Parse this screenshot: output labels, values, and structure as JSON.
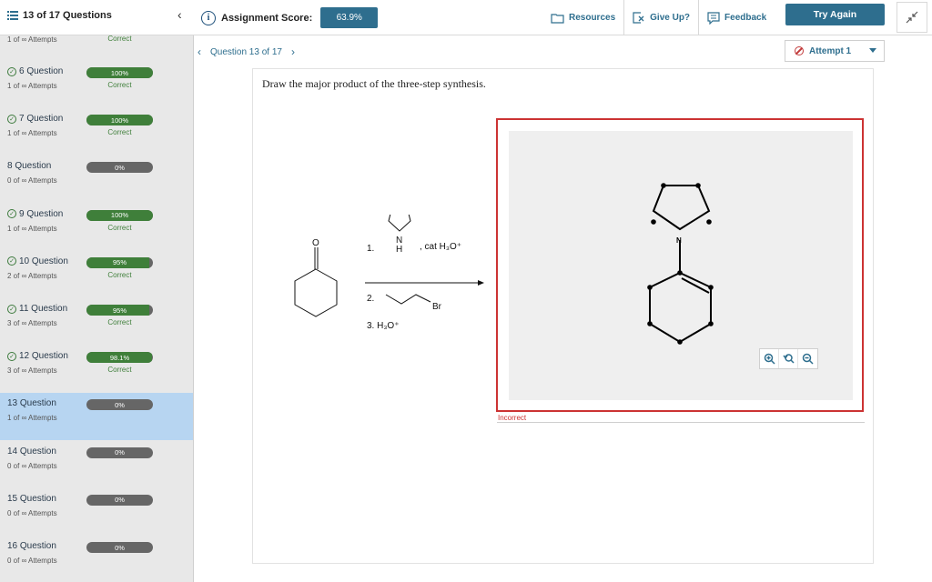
{
  "header": {
    "question_count": "13 of 17 Questions",
    "score_label": "Assignment Score:",
    "score_value": "63.9%",
    "resources_label": "Resources",
    "give_up_label": "Give Up?",
    "feedback_label": "Feedback",
    "try_again_label": "Try Again"
  },
  "sidebar": {
    "partial_top": {
      "attempts": "1 of ∞ Attempts",
      "status": "Correct"
    },
    "items": [
      {
        "title": "6 Question",
        "attempts": "1 of ∞ Attempts",
        "percent": "100%",
        "fill": 1.0,
        "status": "Correct",
        "checked": true
      },
      {
        "title": "7 Question",
        "attempts": "1 of ∞ Attempts",
        "percent": "100%",
        "fill": 1.0,
        "status": "Correct",
        "checked": true
      },
      {
        "title": "8 Question",
        "attempts": "0 of ∞ Attempts",
        "percent": "0%",
        "fill": 0,
        "status": "",
        "checked": false
      },
      {
        "title": "9 Question",
        "attempts": "1 of ∞ Attempts",
        "percent": "100%",
        "fill": 1.0,
        "status": "Correct",
        "checked": true
      },
      {
        "title": "10 Question",
        "attempts": "2 of ∞ Attempts",
        "percent": "95%",
        "fill": 0.95,
        "status": "Correct",
        "checked": true
      },
      {
        "title": "11 Question",
        "attempts": "3 of ∞ Attempts",
        "percent": "95%",
        "fill": 0.95,
        "status": "Correct",
        "checked": true
      },
      {
        "title": "12 Question",
        "attempts": "3 of ∞ Attempts",
        "percent": "98.1%",
        "fill": 0.981,
        "status": "Correct",
        "checked": true
      },
      {
        "title": "13 Question",
        "attempts": "1 of ∞ Attempts",
        "percent": "0%",
        "fill": 0,
        "status": "",
        "checked": false,
        "active": true
      },
      {
        "title": "14 Question",
        "attempts": "0 of ∞ Attempts",
        "percent": "0%",
        "fill": 0,
        "status": "",
        "checked": false
      },
      {
        "title": "15 Question",
        "attempts": "0 of ∞ Attempts",
        "percent": "0%",
        "fill": 0,
        "status": "",
        "checked": false
      },
      {
        "title": "16 Question",
        "attempts": "0 of ∞ Attempts",
        "percent": "0%",
        "fill": 0,
        "status": "",
        "checked": false
      }
    ]
  },
  "main": {
    "question_nav": "Question 13 of 17",
    "attempt_label": "Attempt 1",
    "prompt": "Draw the major product of the three-step synthesis.",
    "scheme": {
      "step1_num": "1.",
      "step1_reagent": ", cat H₃O⁺",
      "step2_num": "2.",
      "step3": "3. H₃O⁺",
      "ketone_o": "O",
      "amine_n": "N",
      "amine_h": "H",
      "bromide": "Br"
    },
    "answer": {
      "nitrogen": "N",
      "feedback": "Incorrect"
    }
  },
  "colors": {
    "accent": "#2e6e8e",
    "correct": "#3f7f3a",
    "error": "#cc3333",
    "active_row": "#b7d5f1"
  }
}
